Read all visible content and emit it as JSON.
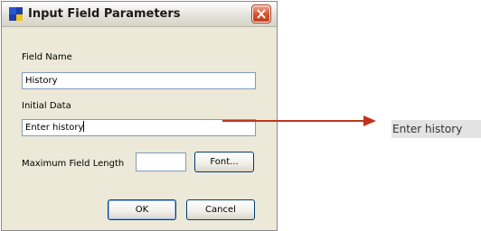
{
  "dialog": {
    "title": "Input Field Parameters",
    "field_name_label": "Field Name",
    "field_name_value": "History",
    "initial_data_label": "Initial Data",
    "initial_data_value": "Enter history",
    "max_length_label": "Maximum Field Length",
    "max_length_value": "",
    "font_button": "Font...",
    "ok_button": "OK",
    "cancel_button": "Cancel"
  },
  "preview": {
    "text": "Enter history"
  },
  "colors": {
    "arrow": "#c0341d",
    "close_button": "#d5552f"
  }
}
